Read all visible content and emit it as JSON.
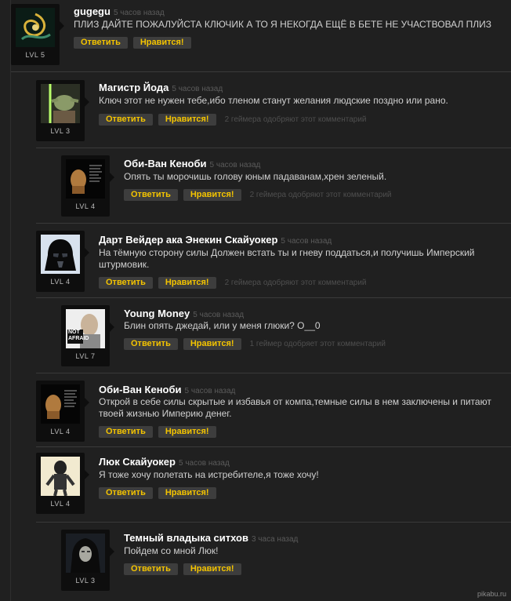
{
  "comments": [
    {
      "author": "gugegu",
      "time": "5 часов назад",
      "text": "ПЛИЗ ДАЙТЕ ПОЖАЛУЙСТА КЛЮЧИК А ТО Я НЕКОГДА ЕЩЁ В БЕТЕ НЕ УЧАСТВОВАЛ ПЛИЗ",
      "level": "LVL 5",
      "reply": "Ответить",
      "like": "Нравится!",
      "approve": ""
    },
    {
      "author": "Магистр Йода",
      "time": "5 часов назад",
      "text": "Ключ этот не нужен тебе,ибо тленом станут желания людские поздно или рано.",
      "level": "LVL 3",
      "reply": "Ответить",
      "like": "Нравится!",
      "approve": "2 геймера одобряют этот комментарий"
    },
    {
      "author": "Оби-Ван Кеноби",
      "time": "5 часов назад",
      "text": "Опять ты морочишь голову юным падаванам,хрен зеленый.",
      "level": "LVL 4",
      "reply": "Ответить",
      "like": "Нравится!",
      "approve": "2 геймера одобряют этот комментарий"
    },
    {
      "author": "Дарт Вейдер ака Энекин Скайуокер",
      "time": "5 часов назад",
      "text": "На тёмную сторону силы Должен встать ты и гневу поддаться,и получишь Имперский штурмовик.",
      "level": "LVL 4",
      "reply": "Ответить",
      "like": "Нравится!",
      "approve": "2 геймера одобряют этот комментарий"
    },
    {
      "author": "Young Money",
      "time": "5 часов назад",
      "text": "Блин опять джедай, или у меня глюки? О__0",
      "level": "LVL 7",
      "reply": "Ответить",
      "like": "Нравится!",
      "approve": "1 геймер одобряет этот комментарий",
      "avatar_text": "NOT AFRAID"
    },
    {
      "author": "Оби-Ван Кеноби",
      "time": "5 часов назад",
      "text": "Открой в себе силы скрытые и избавья от компа,темные силы в нем заключены и питают твоей жизнью Империю денег.",
      "level": "LVL 4",
      "reply": "Ответить",
      "like": "Нравится!",
      "approve": ""
    },
    {
      "author": "Люк Скайуокер",
      "time": "5 часов назад",
      "text": "Я тоже хочу полетать на истребителе,я тоже хочу!",
      "level": "LVL 4",
      "reply": "Ответить",
      "like": "Нравится!",
      "approve": ""
    },
    {
      "author": "Темный владыка ситхов",
      "time": "3 часа назад",
      "text": "Пойдем со мной Люк!",
      "level": "LVL 3",
      "reply": "Ответить",
      "like": "Нравится!",
      "approve": ""
    }
  ],
  "watermark": "pikabu.ru",
  "colors": {
    "background": "#202020",
    "accent": "#f4c400",
    "button": "#3d3d3d"
  }
}
